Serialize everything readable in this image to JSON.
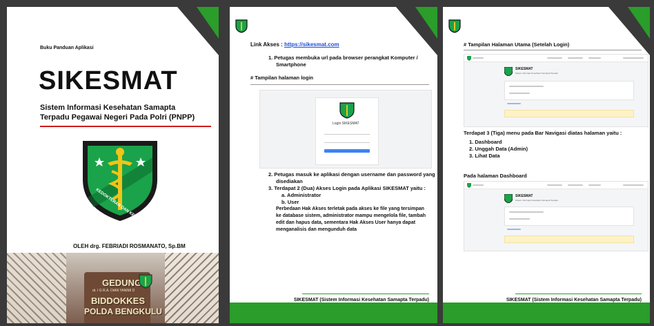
{
  "cover": {
    "guide_label": "Buku Panduan Aplikasi",
    "title": "SIKESMAT",
    "subtitle_line1": "Sistem Informasi Kesehatan Samapta",
    "subtitle_line2": "Terpadu Pegawai Negeri Pada Polri (PNPP)",
    "emblem_text": "KEDOKTERAN DAN KESEHATAN",
    "author": "OLEH drg. FEBRIADI ROSMANATO, Sp.BM",
    "building_sign": [
      "GEDUNG",
      "dr. I G R.A. DIAN YANIMI D",
      "BIDDOKKES",
      "POLDA BENGKULU"
    ]
  },
  "page2": {
    "link_label": "Link Akses : ",
    "link_url": "https://sikesmat.com",
    "step1": "1.  Petugas membuka url pada browser perangkat Komputer /",
    "step1b": "Smartphone",
    "login_heading": "# Tampilan halaman login",
    "login_title": "Login SIKESMAT",
    "step2": "2.  Petugas masuk ke aplikasi dengan username dan password yang",
    "step2b": "disediakan",
    "step3": "3.  Terdapat 2 (Dua) Akses Login pada Aplikasi SIKESMAT yaitu :",
    "role_a": "a.  Administrator",
    "role_b": "b.  User",
    "para": [
      "Perbedaan Hak Akses terletak pada akses ke file yang tersimpan",
      "ke database sistem, administrator mampu mengelola file, tambah",
      "edit dan hapus data, sementara Hak Akses User hanya dapat",
      "menganalisis dan mengunduh data"
    ],
    "footer": "SIKESMAT (Sistem Informasi Kesehatan Samapta Terpadu)"
  },
  "page3": {
    "heading": "# Tampilan Halaman Utama (Setelah Login)",
    "app_name": "SIKESMAT",
    "app_sub": "Sistem Informasi Kesehatan Samapta Terpadu",
    "menu_intro": "Terdapat 3 (Tiga) menu pada Bar Navigasi diatas halaman yaitu :",
    "menu": [
      "1.  Dashboard",
      "2.  Unggah Data (Admin)",
      "3.  Lihat Data"
    ],
    "dashboard_heading": "Pada halaman Dashboard",
    "footer": "SIKESMAT (Sistem Informasi Kesehatan Samapta Terpadu)"
  },
  "colors": {
    "brand_green": "#2a9d2a",
    "dark_grey": "#3a3a3a",
    "red_rule": "#d11b1b",
    "link_blue": "#1d4ed8"
  }
}
